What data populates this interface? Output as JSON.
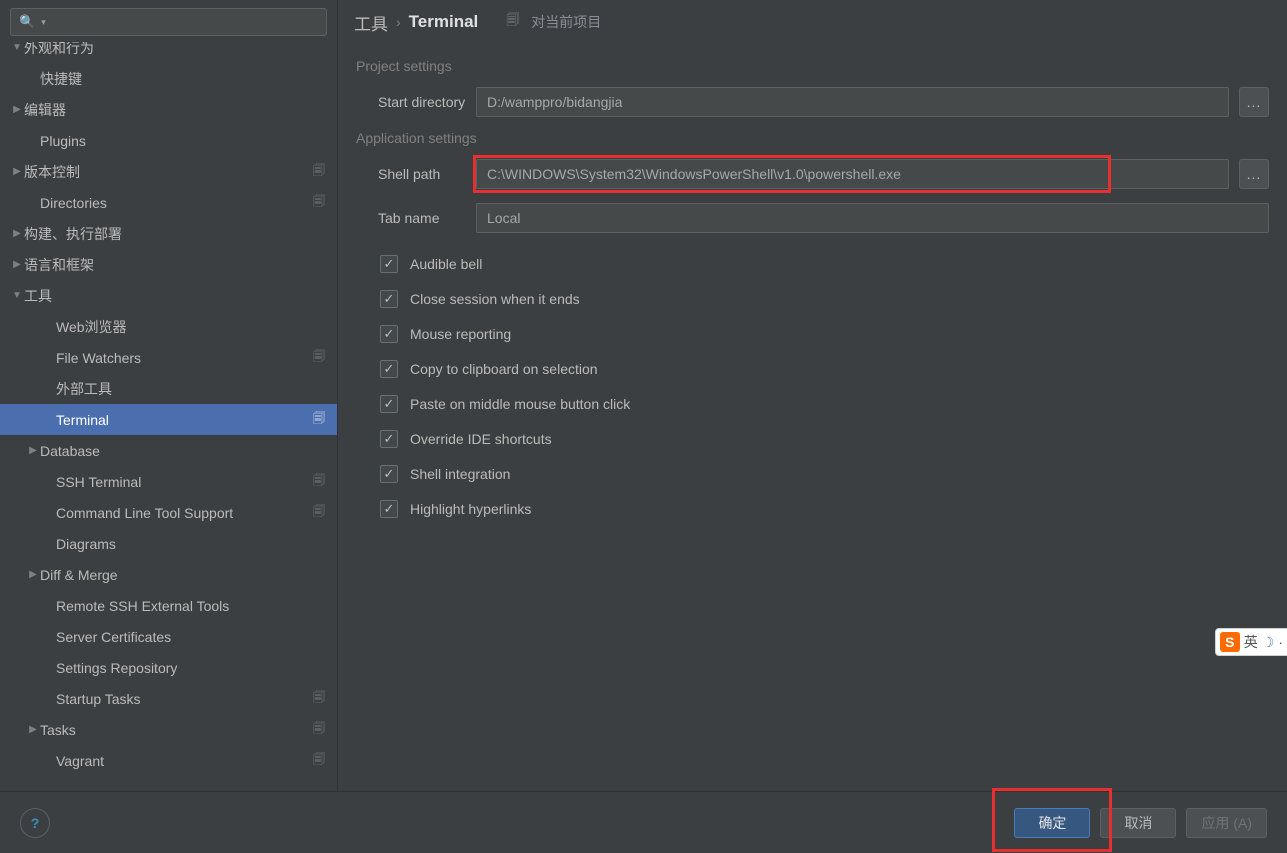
{
  "breadcrumb": {
    "crumb1": "工具",
    "crumb2": "Terminal",
    "scope_label": "对当前项目"
  },
  "sidebar": {
    "search_placeholder": "",
    "items": [
      {
        "label": "外观和行为",
        "level": 0,
        "arrow": "down",
        "trail": false,
        "cut": true
      },
      {
        "label": "快捷键",
        "level": 1,
        "arrow": "",
        "trail": false
      },
      {
        "label": "编辑器",
        "level": 0,
        "arrow": "right",
        "trail": false
      },
      {
        "label": "Plugins",
        "level": 1,
        "arrow": "",
        "trail": false
      },
      {
        "label": "版本控制",
        "level": 0,
        "arrow": "right",
        "trail": true
      },
      {
        "label": "Directories",
        "level": 1,
        "arrow": "",
        "trail": true
      },
      {
        "label": "构建、执行部署",
        "level": 0,
        "arrow": "right",
        "trail": false
      },
      {
        "label": "语言和框架",
        "level": 0,
        "arrow": "right",
        "trail": false
      },
      {
        "label": "工具",
        "level": 0,
        "arrow": "down",
        "trail": false
      },
      {
        "label": "Web浏览器",
        "level": 2,
        "arrow": "",
        "trail": false
      },
      {
        "label": "File Watchers",
        "level": 2,
        "arrow": "",
        "trail": true
      },
      {
        "label": "外部工具",
        "level": 2,
        "arrow": "",
        "trail": false
      },
      {
        "label": "Terminal",
        "level": 2,
        "arrow": "",
        "trail": true,
        "selected": true
      },
      {
        "label": "Database",
        "level": 1,
        "arrow": "right",
        "trail": false
      },
      {
        "label": "SSH Terminal",
        "level": 2,
        "arrow": "",
        "trail": true
      },
      {
        "label": "Command Line Tool Support",
        "level": 2,
        "arrow": "",
        "trail": true
      },
      {
        "label": "Diagrams",
        "level": 2,
        "arrow": "",
        "trail": false
      },
      {
        "label": "Diff & Merge",
        "level": 1,
        "arrow": "right",
        "trail": false
      },
      {
        "label": "Remote SSH External Tools",
        "level": 2,
        "arrow": "",
        "trail": false
      },
      {
        "label": "Server Certificates",
        "level": 2,
        "arrow": "",
        "trail": false
      },
      {
        "label": "Settings Repository",
        "level": 2,
        "arrow": "",
        "trail": false
      },
      {
        "label": "Startup Tasks",
        "level": 2,
        "arrow": "",
        "trail": true
      },
      {
        "label": "Tasks",
        "level": 1,
        "arrow": "right",
        "trail": true
      },
      {
        "label": "Vagrant",
        "level": 2,
        "arrow": "",
        "trail": true
      }
    ]
  },
  "sections": {
    "project_settings": "Project settings",
    "application_settings": "Application settings"
  },
  "form": {
    "start_directory_label": "Start directory",
    "start_directory_value": "D:/wamppro/bidangjia",
    "shell_path_label": "Shell path",
    "shell_path_value": "C:\\WINDOWS\\System32\\WindowsPowerShell\\v1.0\\powershell.exe",
    "tab_name_label": "Tab name",
    "tab_name_value": "Local",
    "ellipsis": "..."
  },
  "checkboxes": [
    "Audible bell",
    "Close session when it ends",
    "Mouse reporting",
    "Copy to clipboard on selection",
    "Paste on middle mouse button click",
    "Override IDE shortcuts",
    "Shell integration",
    "Highlight hyperlinks"
  ],
  "footer": {
    "help": "?",
    "ok": "确定",
    "cancel": "取消",
    "apply": "应用 (A)"
  },
  "ime": {
    "logo": "S",
    "lang": "英",
    "moon": "☽",
    "dot": "·"
  }
}
